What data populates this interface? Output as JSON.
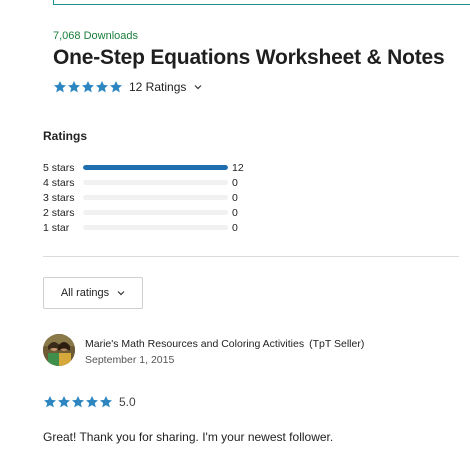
{
  "product": {
    "downloads": "7,068 Downloads",
    "title": "One-Step Equations Worksheet & Notes",
    "rating_count_label": "12 Ratings",
    "stars": 5
  },
  "colors": {
    "star": "#2e86c1",
    "bar_fill": "#1f6fb0",
    "downloads": "#1b7e3a"
  },
  "ratings_section": {
    "heading": "Ratings",
    "rows": [
      {
        "label": "5 stars",
        "count": "12",
        "fraction": 1.0
      },
      {
        "label": "4 stars",
        "count": "0",
        "fraction": 0
      },
      {
        "label": "3 stars",
        "count": "0",
        "fraction": 0
      },
      {
        "label": "2 stars",
        "count": "0",
        "fraction": 0
      },
      {
        "label": "1 star",
        "count": "0",
        "fraction": 0
      }
    ]
  },
  "filter": {
    "selected": "All ratings"
  },
  "review": {
    "author": "Marie's Math Resources and Coloring Activities",
    "author_tag": "(TpT Seller)",
    "date": "September 1, 2015",
    "stars": 5,
    "score": "5.0",
    "text": "Great! Thank you for sharing.  I'm your newest follower."
  }
}
